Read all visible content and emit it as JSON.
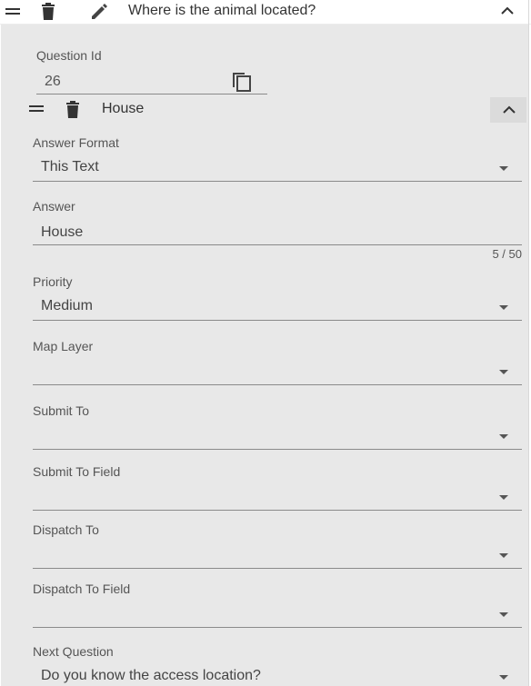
{
  "question": {
    "title": "Where is the animal located?",
    "id_label": "Question Id",
    "id_value": "26",
    "icons": [
      "drag-handle-icon",
      "delete-icon",
      "edit-icon",
      "chevron-up-icon",
      "copy-icon"
    ]
  },
  "answer_item": {
    "title": "House",
    "icons": [
      "drag-handle-icon",
      "delete-icon",
      "chevron-up-icon"
    ]
  },
  "fields": {
    "answer_format": {
      "label": "Answer Format",
      "value": "This Text"
    },
    "answer": {
      "label": "Answer",
      "value": "House",
      "counter": "5 / 50"
    },
    "priority": {
      "label": "Priority",
      "value": "Medium"
    },
    "map_layer": {
      "label": "Map Layer",
      "value": ""
    },
    "submit_to": {
      "label": "Submit To",
      "value": ""
    },
    "submit_to_field": {
      "label": "Submit To Field",
      "value": ""
    },
    "dispatch_to": {
      "label": "Dispatch To",
      "value": ""
    },
    "dispatch_to_field": {
      "label": "Dispatch To Field",
      "value": ""
    },
    "next_question": {
      "label": "Next Question",
      "value": "Do you know the access location?"
    }
  }
}
